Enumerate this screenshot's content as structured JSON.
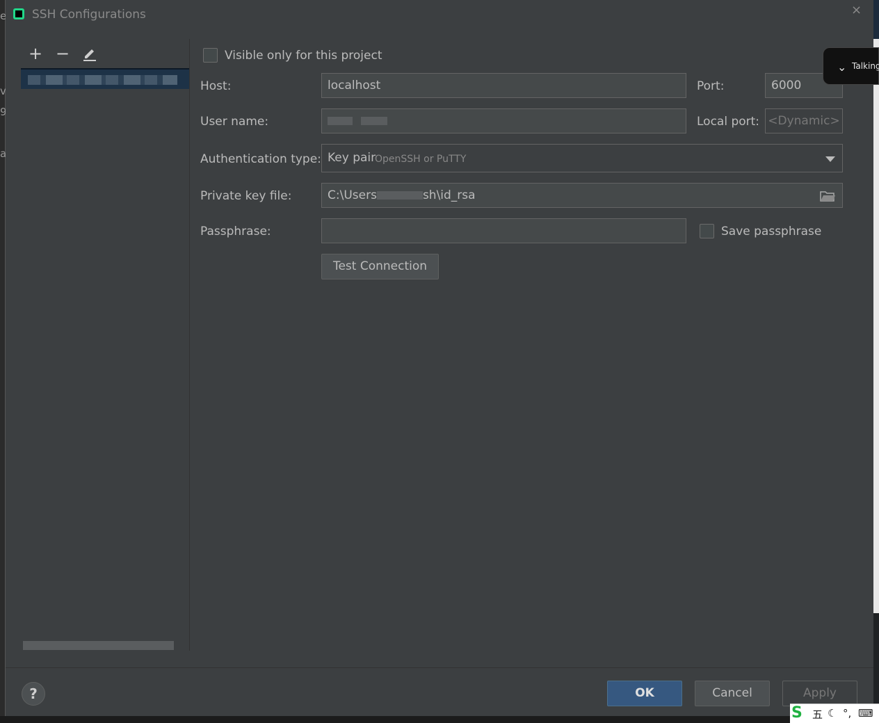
{
  "dialog": {
    "title": "SSH Configurations",
    "close_label": "×"
  },
  "toolbar": {
    "add_label": "+",
    "remove_label": "−"
  },
  "form": {
    "visible_only_label": "Visible only for this project",
    "host_label": "Host:",
    "host_value": "localhost",
    "port_label": "Port:",
    "port_value": "6000",
    "user_label": "User name:",
    "local_port_label": "Local port:",
    "local_port_placeholder": "<Dynamic>",
    "auth_label": "Authentication type:",
    "auth_value": "Key pair",
    "auth_hint": "OpenSSH or PuTTY",
    "private_key_label": "Private key file:",
    "private_key_prefix": "C:\\Users",
    "private_key_suffix": "sh\\id_rsa",
    "passphrase_label": "Passphrase:",
    "save_passphrase_label": "Save passphrase",
    "test_connection_label": "Test Connection"
  },
  "footer": {
    "help_label": "?",
    "ok_label": "OK",
    "cancel_label": "Cancel",
    "apply_label": "Apply"
  },
  "overlay": {
    "talking_label": "Talking"
  },
  "ime": {
    "logo": "S",
    "mode": "五"
  }
}
